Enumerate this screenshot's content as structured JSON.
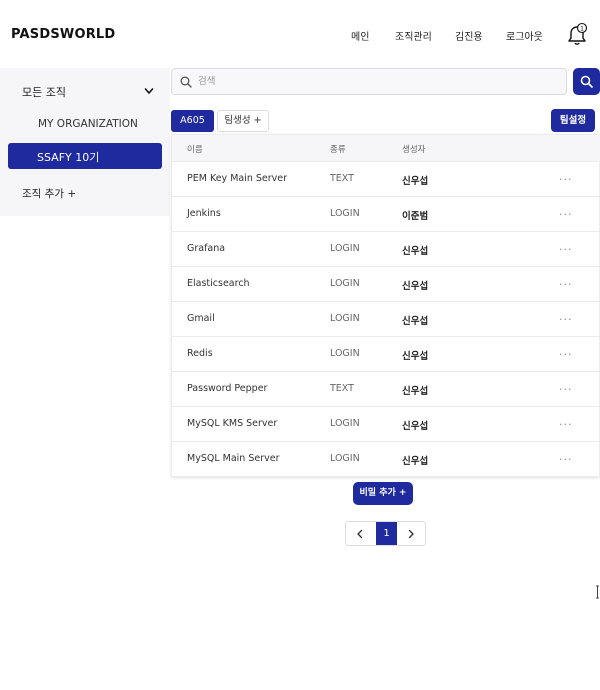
{
  "header": {
    "brand": "PASDSWORLD",
    "nav": [
      "메인",
      "조직관리",
      "김진용",
      "로그아웃"
    ],
    "notification_count": "1",
    "notification_icon": "bell-icon"
  },
  "sidebar": {
    "all_orgs_label": "모든 조직",
    "items": [
      {
        "label": "MY ORGANIZATION",
        "active": false
      },
      {
        "label": "SSAFY 10기",
        "active": true
      }
    ],
    "add_org_label": "조직 추가 +"
  },
  "search": {
    "placeholder": "검색",
    "value": ""
  },
  "tabs": {
    "active_label": "A605",
    "add_label": "팀생성 +"
  },
  "team_settings_label": "팀설정",
  "table": {
    "headers": [
      "이름",
      "종류",
      "생성자"
    ],
    "rows": [
      {
        "name": "PEM Key Main Server",
        "type": "TEXT",
        "creator": "신우섭",
        "more": "..."
      },
      {
        "name": "Jenkins",
        "type": "LOGIN",
        "creator": "이준범",
        "more": "..."
      },
      {
        "name": "Grafana",
        "type": "LOGIN",
        "creator": "신우섭",
        "more": "..."
      },
      {
        "name": "Elasticsearch",
        "type": "LOGIN",
        "creator": "신우섭",
        "more": "..."
      },
      {
        "name": "Gmail",
        "type": "LOGIN",
        "creator": "신우섭",
        "more": "..."
      },
      {
        "name": "Redis",
        "type": "LOGIN",
        "creator": "신우섭",
        "more": "..."
      },
      {
        "name": "Password Pepper",
        "type": "TEXT",
        "creator": "신우섭",
        "more": "..."
      },
      {
        "name": "MySQL KMS Server",
        "type": "LOGIN",
        "creator": "신우섭",
        "more": "..."
      },
      {
        "name": "MySQL Main Server",
        "type": "LOGIN",
        "creator": "신우섭",
        "more": "..."
      }
    ]
  },
  "add_secret_label": "비밀 추가 +",
  "pagination": {
    "current_page": "1"
  },
  "colors": {
    "accent": "#1e2a9e",
    "sidebar_bg": "#f6f6f9"
  }
}
